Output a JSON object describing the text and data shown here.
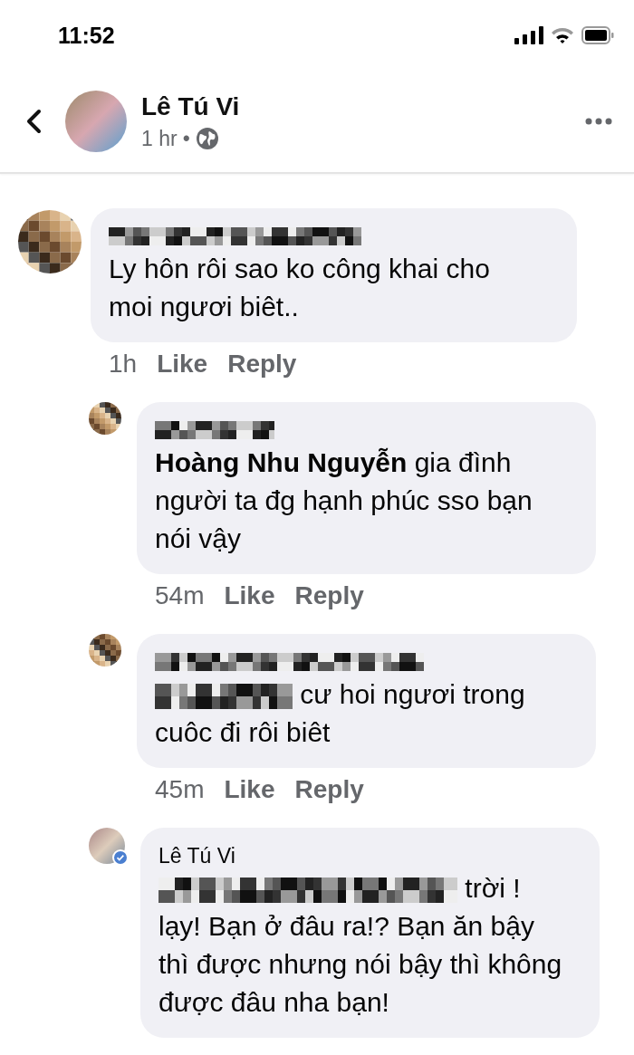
{
  "status_bar": {
    "time": "11:52"
  },
  "header": {
    "name": "Lê Tú Vi",
    "time": "1 hr",
    "separator": "•"
  },
  "comments": [
    {
      "kind": "top",
      "avatar": {
        "kind": "pixelated"
      },
      "verified": false,
      "author": {
        "kind": "pixelated"
      },
      "body": "Ly hôn rôi sao ko công khai cho moi ngươi biêt..",
      "time": "1h",
      "like": "Like",
      "reply": "Reply"
    },
    {
      "kind": "reply",
      "avatar": {
        "kind": "pixelated"
      },
      "verified": false,
      "author": {
        "kind": "pixelated"
      },
      "mention": {
        "kind": "name",
        "text": "Hoàng Nhu Nguyễn"
      },
      "body": " gia đình người ta đg hạnh phúc sso bạn nói vậy",
      "time": "54m",
      "like": "Like",
      "reply": "Reply"
    },
    {
      "kind": "reply",
      "avatar": {
        "kind": "pixelated"
      },
      "verified": false,
      "author": {
        "kind": "pixelated"
      },
      "mention": {
        "kind": "pixelated"
      },
      "body": " cư hoi ngươi trong cuôc đi rôi biêt",
      "time": "45m",
      "like": "Like",
      "reply": "Reply"
    },
    {
      "kind": "reply",
      "avatar": {
        "kind": "photo"
      },
      "verified": true,
      "author": {
        "kind": "name",
        "text": "Lê Tú Vi"
      },
      "mention": {
        "kind": "pixelated"
      },
      "body": " trời ! lạy! Bạn ở đâu ra!? Bạn ăn bậy thì được nhưng nói bậy thì không được đâu nha bạn!"
    }
  ]
}
